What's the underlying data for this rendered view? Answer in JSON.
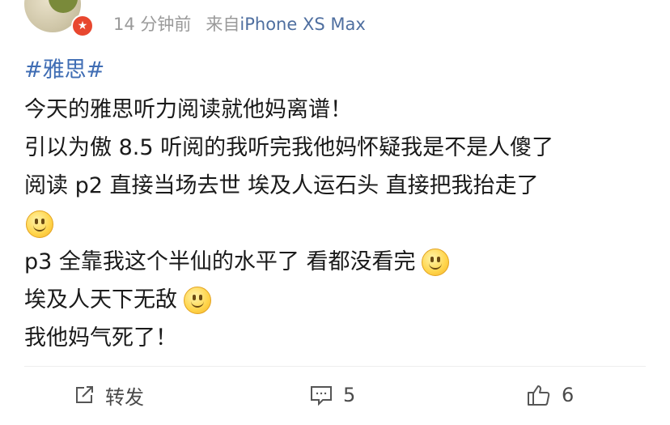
{
  "post": {
    "time": "14 分钟前",
    "source_prefix": "来自",
    "device": "iPhone XS Max",
    "hashtag": "#雅思#",
    "lines": [
      "今天的雅思听力阅读就他妈离谱！",
      "引以为傲 8.5 听阅的我听完我他妈怀疑我是不是人傻了",
      "阅读 p2 直接当场去世  埃及人运石头  直接把我抬走了",
      "p3 全靠我这个半仙的水平了  看都没看完",
      "埃及人天下无敌",
      "我他妈气死了！"
    ],
    "emoji_icon": "smile-emoji-icon"
  },
  "actions": {
    "repost_label": "转发",
    "comment_count": "5",
    "like_count": "6"
  },
  "colors": {
    "link": "#3f6db4",
    "meta": "#9a9a9a",
    "badge": "#e8472f"
  }
}
